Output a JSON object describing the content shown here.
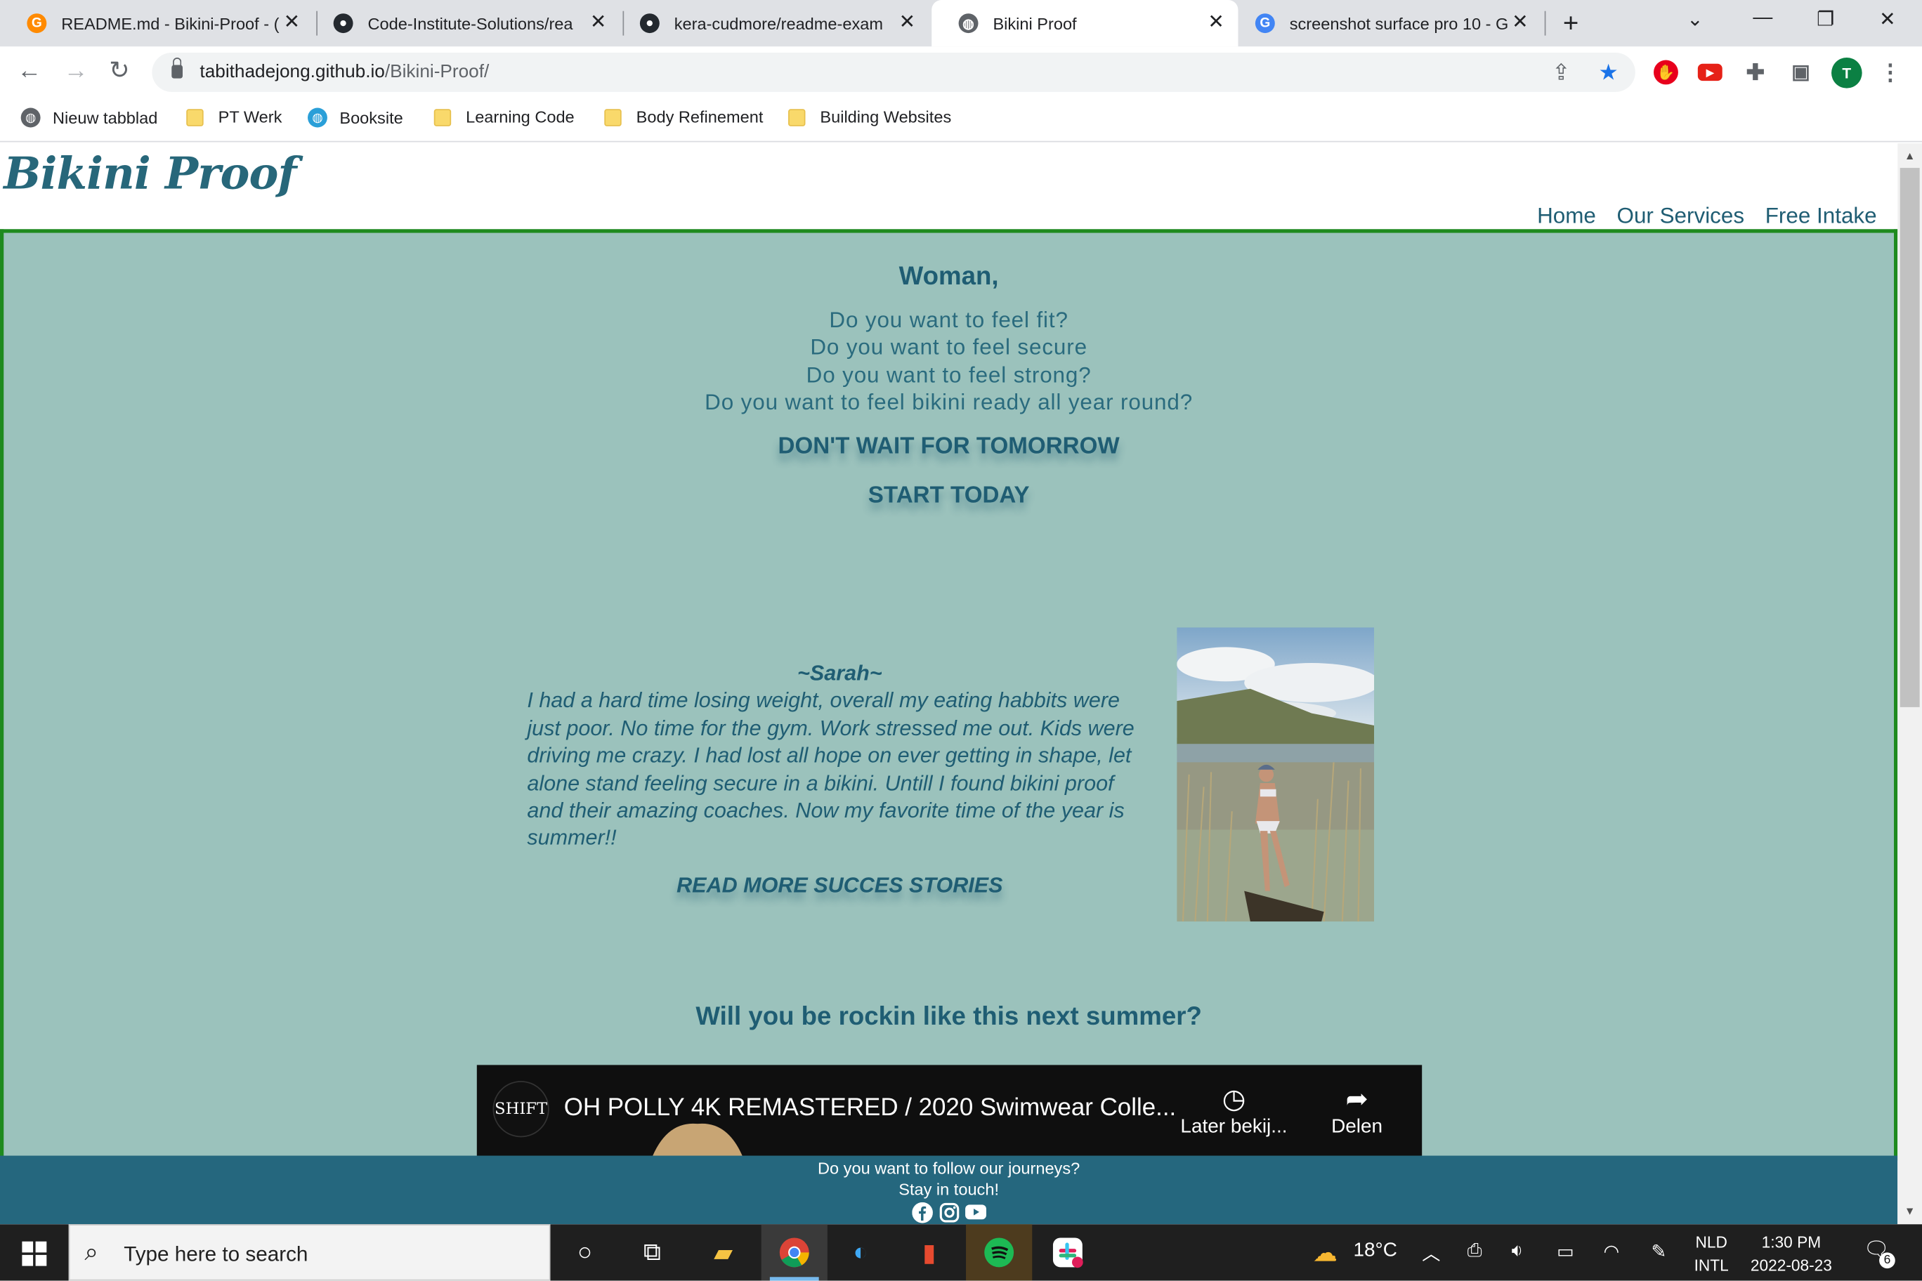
{
  "browser": {
    "tabs": [
      {
        "title": "README.md - Bikini-Proof - (",
        "icon": "gitpod-icon",
        "active": false
      },
      {
        "title": "Code-Institute-Solutions/rea",
        "icon": "github-icon",
        "active": false
      },
      {
        "title": "kera-cudmore/readme-exam",
        "icon": "github-icon",
        "active": false
      },
      {
        "title": "Bikini Proof",
        "icon": "globe-icon",
        "active": true
      },
      {
        "title": "screenshot surface pro 10 - G",
        "icon": "google-icon",
        "active": false
      }
    ],
    "url_host": "tabithadejong.github.io",
    "url_path": "/Bikini-Proof/",
    "profile_initial": "T",
    "bookmarks": [
      {
        "label": "Nieuw tabblad",
        "type": "globe"
      },
      {
        "label": "PT Werk",
        "type": "folder"
      },
      {
        "label": "Booksite",
        "type": "globe"
      },
      {
        "label": "Learning Code",
        "type": "folder"
      },
      {
        "label": "Body Refinement",
        "type": "folder"
      },
      {
        "label": "Building Websites",
        "type": "folder"
      }
    ]
  },
  "site": {
    "brand": "Bikini Proof",
    "nav": [
      "Home",
      "Our Services",
      "Free Intake"
    ],
    "hero": {
      "title": "Woman,",
      "lines": [
        "Do you want to feel fit?",
        "Do you want to feel secure",
        "Do you want to feel strong?",
        "Do you want to feel bikini ready all year round?"
      ],
      "cta_1": "DON'T WAIT FOR TOMORROW",
      "cta_2": "START TODAY"
    },
    "testimonial": {
      "name": "~Sarah~",
      "text": "I had a hard time losing weight, overall my eating habbits were just poor. No time for the gym. Work stressed me out. Kids were driving me crazy. I had lost all hope on ever getting in shape, let alone stand feeling secure in a bikini. Untill I found bikini proof and their amazing coaches. Now my favorite time of the year is summer!!",
      "read_more": "READ MORE SUCCES STORIES"
    },
    "question": "Will you be rockin like this next summer?",
    "video": {
      "channel_logo": "SHIFT",
      "title": "OH POLLY 4K REMASTERED / 2020 Swimwear Colle...",
      "watch_later": "Later bekij...",
      "share": "Delen"
    },
    "footer": {
      "line_1": "Do you want to follow our journeys?",
      "line_2": "Stay in touch!",
      "social": [
        "facebook-icon",
        "instagram-icon",
        "youtube-icon"
      ]
    }
  },
  "taskbar": {
    "search_placeholder": "Type here to search",
    "weather": "18°C",
    "lang_1": "NLD",
    "lang_2": "INTL",
    "time": "1:30 PM",
    "date": "2022-08-23",
    "notifications": "6"
  },
  "colors": {
    "brand": "#27677a",
    "page_bg": "#9bc2bc",
    "border": "#1e8a1e",
    "footer": "#25677e"
  }
}
